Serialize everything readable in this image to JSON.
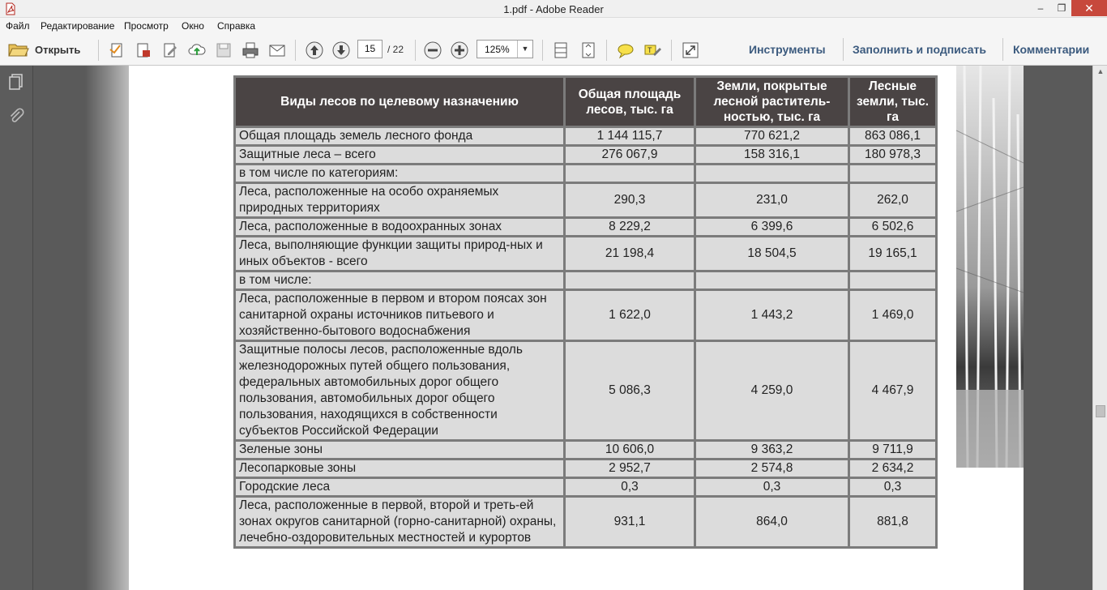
{
  "window": {
    "title": "1.pdf - Adobe Reader",
    "minimize": "–",
    "maximize": "❐",
    "close": "✕"
  },
  "menu": [
    "Файл",
    "Редактирование",
    "Просмотр",
    "Окно",
    "Справка"
  ],
  "toolbar": {
    "open_label": "Открыть",
    "page_current": "15",
    "page_total": "/ 22",
    "zoom": "125%",
    "right_links": [
      "Инструменты",
      "Заполнить и подписать",
      "Комментарии"
    ]
  },
  "table": {
    "headers": [
      "Виды лесов по целевому назначению",
      "Общая площадь лесов, тыс. га",
      "Земли, покрытые лесной раститель-ностью, тыс. га",
      "Лесные земли, тыс. га"
    ],
    "rows": [
      [
        "Общая площадь земель лесного фонда",
        "1 144 115,7",
        "770 621,2",
        "863 086,1"
      ],
      [
        "Защитные леса – всего",
        "276 067,9",
        "158 316,1",
        "180 978,3"
      ],
      [
        "в том числе по категориям:",
        "",
        "",
        ""
      ],
      [
        "Леса, расположенные на особо охраняемых природных территориях",
        "290,3",
        "231,0",
        "262,0"
      ],
      [
        "Леса, расположенные в водоохранных зонах",
        "8 229,2",
        "6 399,6",
        "6 502,6"
      ],
      [
        "Леса, выполняющие функции защиты природ-ных и иных объектов - всего",
        "21 198,4",
        "18 504,5",
        "19 165,1"
      ],
      [
        "в том числе:",
        "",
        "",
        ""
      ],
      [
        "Леса, расположенные в первом и втором поясах зон санитарной охраны источников питьевого и хозяйственно-бытового водоснабжения",
        "1 622,0",
        "1 443,2",
        "1 469,0"
      ],
      [
        "Защитные полосы лесов, расположенные вдоль железнодорожных путей общего пользования, федеральных автомобильных дорог общего пользования, автомобильных дорог общего пользования, находящихся в собственности субъектов Российской Федерации",
        "5 086,3",
        "4 259,0",
        "4 467,9"
      ],
      [
        "Зеленые зоны",
        "10 606,0",
        "9 363,2",
        "9 711,9"
      ],
      [
        "Лесопарковые зоны",
        "2 952,7",
        "2 574,8",
        "2 634,2"
      ],
      [
        "Городские леса",
        "0,3",
        "0,3",
        "0,3"
      ],
      [
        "Леса, расположенные в первой, второй и треть-ей зонах округов санитарной (горно-санитарной) охраны, лечебно-оздоровительных местностей и курортов",
        "931,1",
        "864,0",
        "881,8"
      ]
    ]
  }
}
